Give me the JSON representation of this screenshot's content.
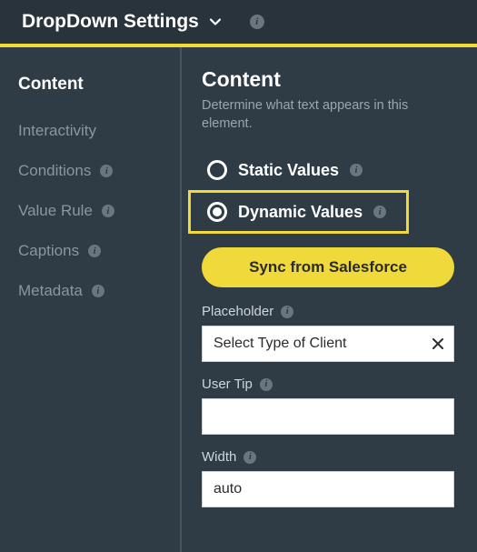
{
  "header": {
    "title": "DropDown Settings"
  },
  "sidebar": {
    "items": [
      {
        "label": "Content",
        "active": true,
        "info": false
      },
      {
        "label": "Interactivity",
        "active": false,
        "info": false
      },
      {
        "label": "Conditions",
        "active": false,
        "info": true
      },
      {
        "label": "Value Rule",
        "active": false,
        "info": true
      },
      {
        "label": "Captions",
        "active": false,
        "info": true
      },
      {
        "label": "Metadata",
        "active": false,
        "info": true
      }
    ]
  },
  "main": {
    "heading": "Content",
    "description": "Determine what text appears in this element.",
    "options": {
      "static_label": "Static Values",
      "dynamic_label": "Dynamic Values",
      "selected": "dynamic"
    },
    "sync_button": "Sync from Salesforce",
    "fields": {
      "placeholder": {
        "label": "Placeholder",
        "value": "Select Type of Client"
      },
      "user_tip": {
        "label": "User Tip",
        "value": ""
      },
      "width": {
        "label": "Width",
        "value": "auto"
      }
    }
  }
}
